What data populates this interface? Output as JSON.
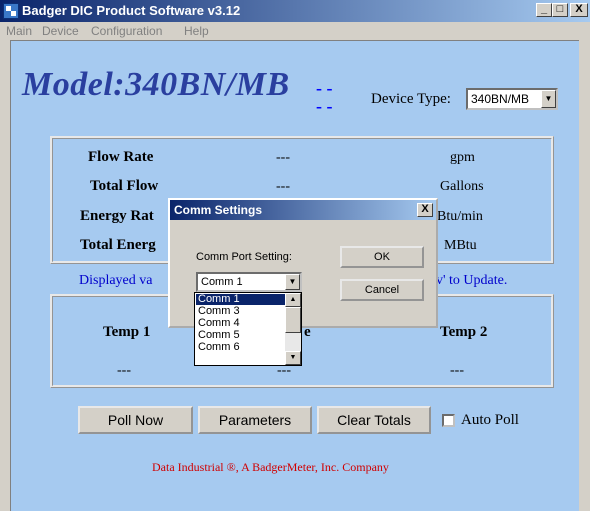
{
  "window": {
    "title": "Badger DIC Product Software v3.12",
    "minimize": "_",
    "maximize": "□",
    "close": "X"
  },
  "menu": [
    "Main",
    "Device",
    "Configuration",
    "Help"
  ],
  "model": {
    "title": "Model:340BN/MB",
    "dashes": "- -",
    "device_type_label": "Device Type:",
    "device_type_value": "340BN/MB"
  },
  "readings": {
    "rows": [
      {
        "label": "Flow Rate",
        "value": "---",
        "unit": "gpm"
      },
      {
        "label": "Total Flow",
        "value": "---",
        "unit": "Gallons"
      },
      {
        "label": "Energy Rat",
        "value": "---",
        "unit": "kBtu/min"
      },
      {
        "label": "Total Energ",
        "value": "---",
        "unit": "MBtu"
      }
    ]
  },
  "note": {
    "left": "Displayed va",
    "right": "v' to Update."
  },
  "temps": {
    "temp1_label": "Temp 1",
    "temp_mid_label": "e",
    "temp2_label": "Temp 2",
    "temp1_value": "---",
    "temp_mid_value": "---",
    "temp2_value": "---"
  },
  "buttons": {
    "poll_now": "Poll Now",
    "parameters": "Parameters",
    "clear_totals": "Clear Totals",
    "auto_poll": "Auto Poll"
  },
  "footer": "Data Industrial ®, A BadgerMeter, Inc. Company",
  "dialog": {
    "title": "Comm Settings",
    "close": "X",
    "port_label": "Comm Port Setting:",
    "port_value": "Comm 1",
    "ok": "OK",
    "cancel": "Cancel",
    "options": [
      "Comm 1",
      "Comm 3",
      "Comm 4",
      "Comm 5",
      "Comm 6"
    ],
    "selected_index": 0
  }
}
